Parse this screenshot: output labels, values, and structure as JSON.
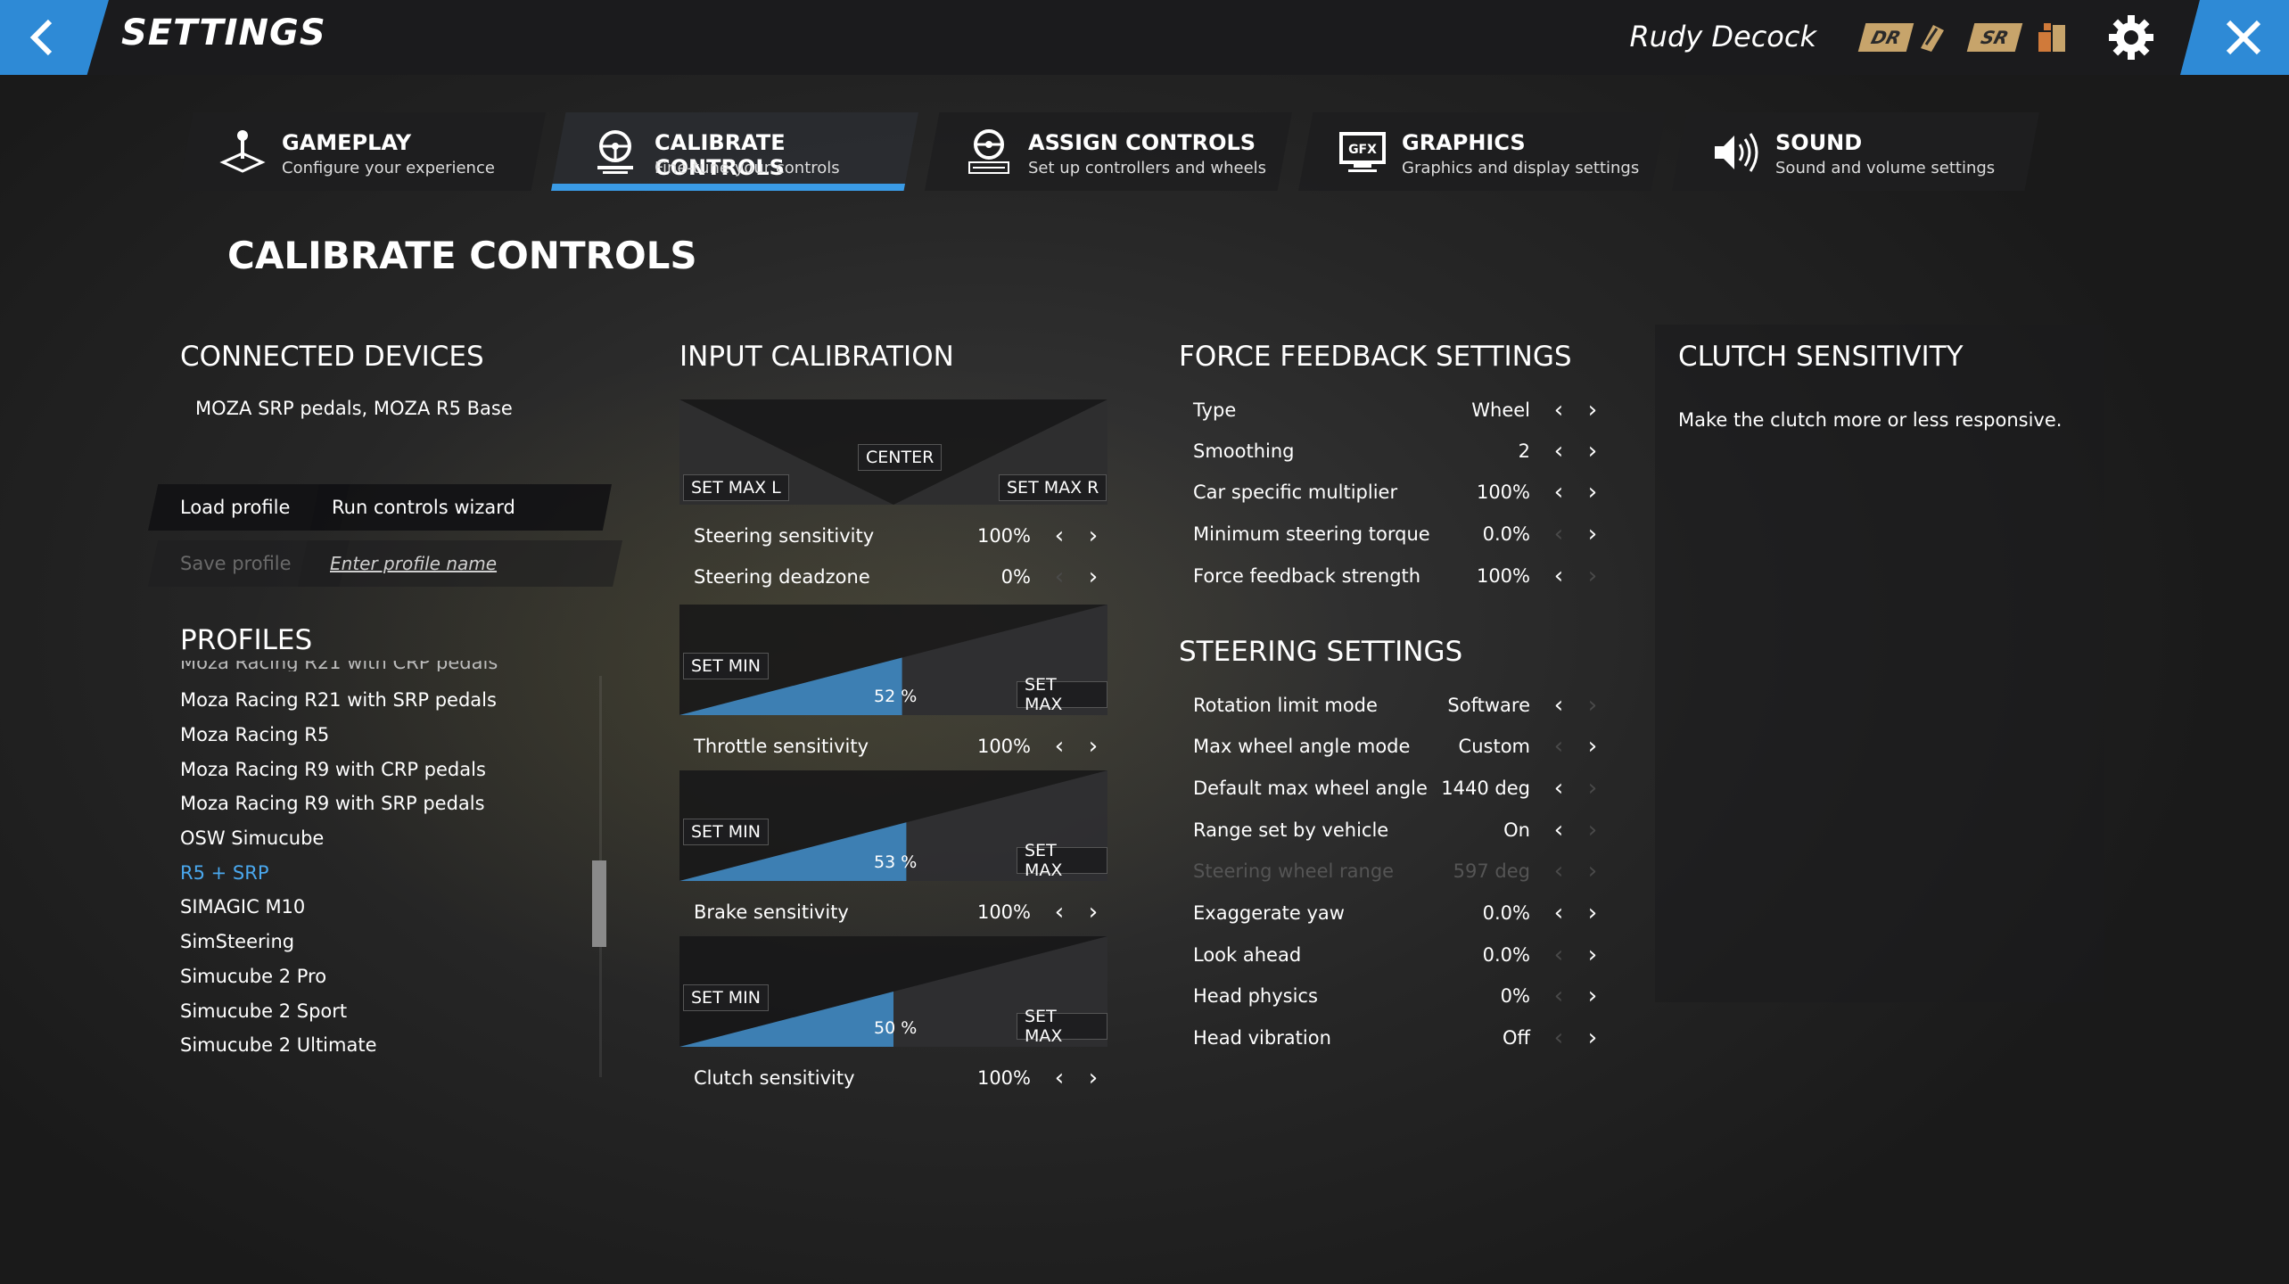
{
  "header": {
    "title": "SETTINGS",
    "user": "Rudy Decock",
    "badges": [
      "DR",
      "SR"
    ]
  },
  "tabs": [
    {
      "title": "GAMEPLAY",
      "sub": "Configure your experience"
    },
    {
      "title": "CALIBRATE CONTROLS",
      "sub": "Fine-tune your controls"
    },
    {
      "title": "ASSIGN CONTROLS",
      "sub": "Set up controllers and wheels"
    },
    {
      "title": "GRAPHICS",
      "sub": "Graphics and display settings",
      "icon_text": "GFX"
    },
    {
      "title": "SOUND",
      "sub": "Sound and volume settings"
    }
  ],
  "page_title": "CALIBRATE CONTROLS",
  "connected": {
    "title": "CONNECTED DEVICES",
    "devices": "MOZA SRP pedals, MOZA R5 Base",
    "load_profile": "Load profile",
    "run_wizard": "Run controls wizard",
    "save_profile": "Save profile",
    "profile_name_placeholder": "Enter profile name"
  },
  "profiles": {
    "title": "PROFILES",
    "items": [
      "Moza Racing R21 with SRP pedals",
      "Moza Racing R5",
      "Moza Racing R9 with CRP pedals",
      "Moza Racing R9 with SRP pedals",
      "OSW Simucube",
      "R5 + SRP",
      "SIMAGIC M10",
      "SimSteering",
      "Simucube 2 Pro",
      "Simucube 2 Sport",
      "Simucube 2 Ultimate"
    ],
    "selected": "R5 + SRP"
  },
  "input_calibration": {
    "title": "INPUT CALIBRATION",
    "center": "CENTER",
    "set_max_l": "SET MAX L",
    "set_max_r": "SET MAX R",
    "set_min": "SET MIN",
    "set_max": "SET MAX",
    "steering_sensitivity": {
      "label": "Steering sensitivity",
      "value": "100%"
    },
    "steering_deadzone": {
      "label": "Steering deadzone",
      "value": "0%"
    },
    "throttle": {
      "percent": "52",
      "unit": "%",
      "level": 0.52,
      "label": "Throttle sensitivity",
      "value": "100%"
    },
    "brake": {
      "percent": "53",
      "unit": "%",
      "level": 0.53,
      "label": "Brake sensitivity",
      "value": "100%"
    },
    "clutch": {
      "percent": "50",
      "unit": "%",
      "level": 0.5,
      "label": "Clutch sensitivity",
      "value": "100%"
    }
  },
  "force_feedback": {
    "title": "FORCE FEEDBACK SETTINGS",
    "rows": [
      {
        "label": "Type",
        "value": "Wheel"
      },
      {
        "label": "Smoothing",
        "value": "2"
      },
      {
        "label": "Car specific multiplier",
        "value": "100%"
      },
      {
        "label": "Minimum steering torque",
        "value": "0.0%"
      },
      {
        "label": "Force feedback strength",
        "value": "100%"
      }
    ]
  },
  "steering": {
    "title": "STEERING SETTINGS",
    "rows": [
      {
        "label": "Rotation limit mode",
        "value": "Software"
      },
      {
        "label": "Max wheel angle mode",
        "value": "Custom"
      },
      {
        "label": "Default max wheel angle",
        "value": "1440 deg"
      },
      {
        "label": "Range set by vehicle",
        "value": "On"
      },
      {
        "label": "Steering wheel range",
        "value": "597 deg"
      },
      {
        "label": "Exaggerate yaw",
        "value": "0.0%"
      },
      {
        "label": "Look ahead",
        "value": "0.0%"
      },
      {
        "label": "Head physics",
        "value": "0%"
      },
      {
        "label": "Head vibration",
        "value": "Off"
      }
    ]
  },
  "clutch_panel": {
    "title": "CLUTCH SENSITIVITY",
    "description": "Make the clutch more or less responsive."
  },
  "colors": {
    "accent": "#2e8ad6",
    "selected_text": "#4aa8ee",
    "bar_fill": "#3d7fb3"
  }
}
